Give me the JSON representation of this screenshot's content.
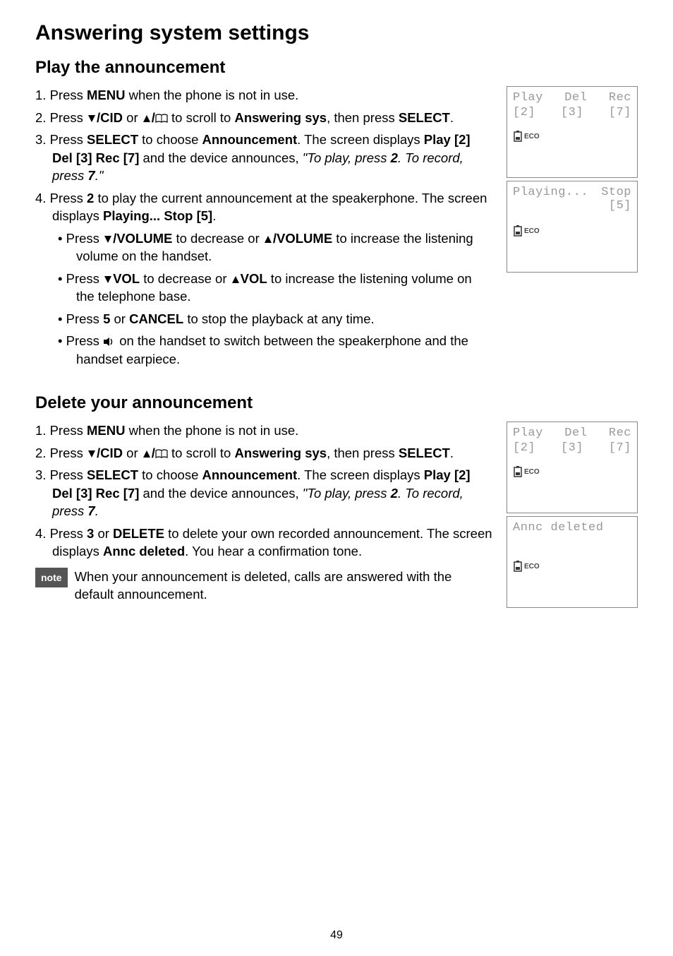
{
  "title": "Answering system settings",
  "section1": {
    "heading": "Play the announcement",
    "step1_pre": "Press ",
    "step1_menu": "MENU",
    "step1_post": " when the phone is not in use.",
    "step2_pre": "Press ",
    "step2_cid": "/CID",
    "step2_or": " or ",
    "step2_scroll": " to scroll to ",
    "step2_target": "Answering sys",
    "step2_then": ", then press ",
    "step2_select": "SELECT",
    "step2_dot": ".",
    "step3_pre": "Press ",
    "step3_select": "SELECT",
    "step3_choose": " to choose ",
    "step3_announce": "Announcement",
    "step3_screen": ". The screen displays ",
    "step3_playdel": "Play [2] Del [3] Rec [7]",
    "step3_device": " and the device announces, ",
    "step3_quote_a": "\"To play, press ",
    "step3_quote_2": "2",
    "step3_quote_b": ". To record, press ",
    "step3_quote_7": "7",
    "step3_quote_c": ".\"",
    "step4_pre": "Press ",
    "step4_two": "2",
    "step4_mid": " to play the current announcement at the speakerphone. The screen displays ",
    "step4_stop": "Playing... Stop [5]",
    "step4_dot": ".",
    "b1_pre": "Press ",
    "b1_down": "/VOLUME",
    "b1_dec": " to decrease or ",
    "b1_up": "/VOLUME",
    "b1_post": " to increase the listening volume on the handset.",
    "b2_pre": "Press ",
    "b2_down": "VOL",
    "b2_dec": " to decrease or ",
    "b2_up": "VOL",
    "b2_post": " to increase the listening volume on the telephone base.",
    "b3_pre": "Press ",
    "b3_five": "5",
    "b3_or": " or ",
    "b3_cancel": "CANCEL",
    "b3_post": " to stop the playback at any time.",
    "b4_pre": "Press ",
    "b4_post": " on the handset to switch between the speakerphone and the handset earpiece."
  },
  "section2": {
    "heading": "Delete your announcement",
    "step1_pre": "Press ",
    "step1_menu": "MENU",
    "step1_post": " when the phone is not in use.",
    "step2_pre": "Press ",
    "step2_cid": "/CID",
    "step2_or": " or ",
    "step2_scroll": " to scroll to ",
    "step2_target": "Answering sys",
    "step2_then": ", then press ",
    "step2_select": "SELECT",
    "step2_dot": ".",
    "step3_pre": "Press ",
    "step3_select": "SELECT",
    "step3_choose": " to choose ",
    "step3_announce": "Announcement",
    "step3_screen": ". The screen displays ",
    "step3_playdel": "Play [2] Del [3] Rec [7]",
    "step3_device": " and the device announces, ",
    "step3_quote_a": "\"To play, press ",
    "step3_quote_2": "2",
    "step3_quote_b": ". To record, press ",
    "step3_quote_7": "7",
    "step3_quote_c": ".",
    "step4_pre": "Press ",
    "step4_three": "3",
    "step4_or": " or ",
    "step4_delete": "DELETE",
    "step4_mid": " to delete your own recorded announcement. The screen displays ",
    "step4_annc": "Annc deleted",
    "step4_end": ". You hear a confirmation tone."
  },
  "note": {
    "badge": "note",
    "text": "When your announcement is deleted, calls are answered with the default announcement."
  },
  "screens": {
    "s1": {
      "a": "Play",
      "b": "Del",
      "c": "Rec",
      "d": "[2]",
      "e": "[3]",
      "f": "[7]",
      "eco": "ECO"
    },
    "s2": {
      "a": "Playing...",
      "b": "Stop",
      "c": "[5]",
      "eco": "ECO"
    },
    "s3": {
      "a": "Play",
      "b": "Del",
      "c": "Rec",
      "d": "[2]",
      "e": "[3]",
      "f": "[7]",
      "eco": "ECO"
    },
    "s4": {
      "a": "Annc deleted",
      "eco": "ECO"
    }
  },
  "pageNumber": "49"
}
